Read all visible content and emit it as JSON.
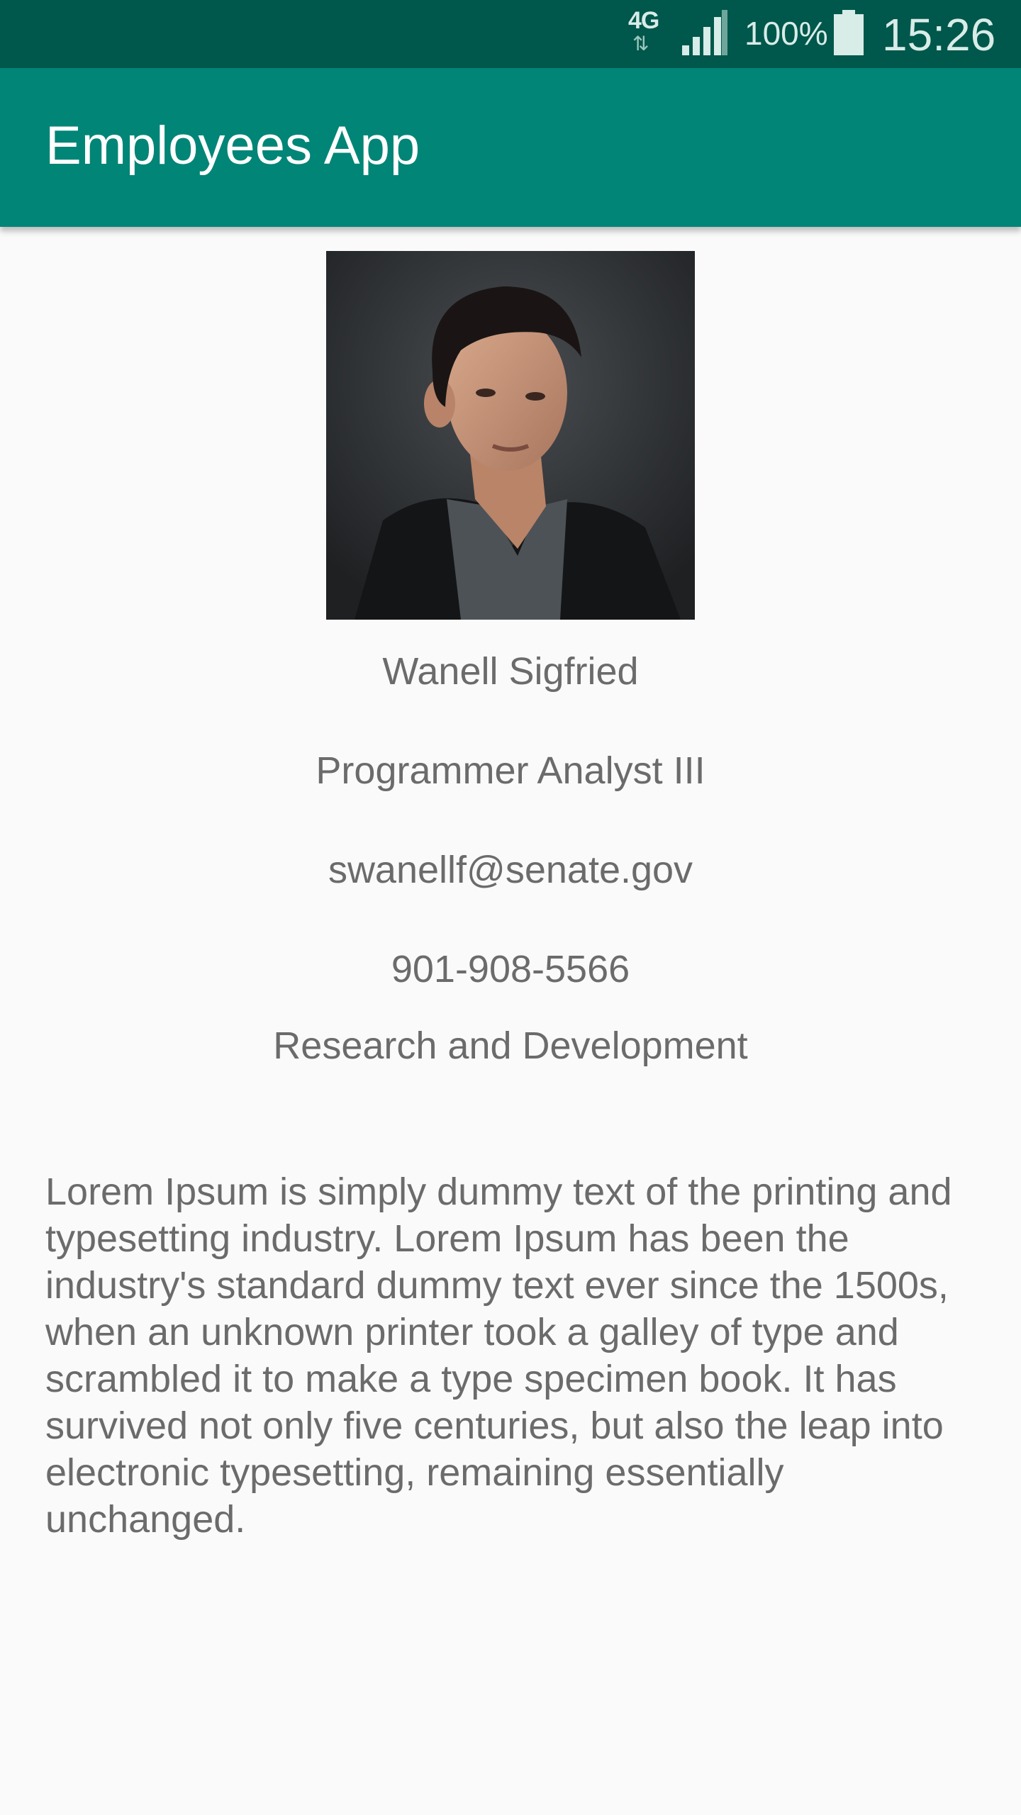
{
  "status_bar": {
    "network": "4G",
    "battery": "100%",
    "time": "15:26",
    "icons": [
      "network-4g-icon",
      "signal-icon",
      "battery-icon"
    ]
  },
  "app_bar": {
    "title": "Employees App",
    "color": "#008577",
    "status_color": "#00574b"
  },
  "employee": {
    "photo": "employee-photo",
    "name": "Wanell Sigfried",
    "job_title": "Programmer Analyst III",
    "email": "swanellf@senate.gov",
    "phone": "901-908-5566",
    "department": "Research and Development",
    "bio": "Lorem Ipsum is simply dummy text of the printing and typesetting industry. Lorem Ipsum has been the industry's standard dummy text ever since the 1500s, when an unknown printer took a galley of type and scrambled it to make a type specimen book. It has survived not only five centuries, but also the leap into electronic typesetting, remaining essentially unchanged."
  }
}
